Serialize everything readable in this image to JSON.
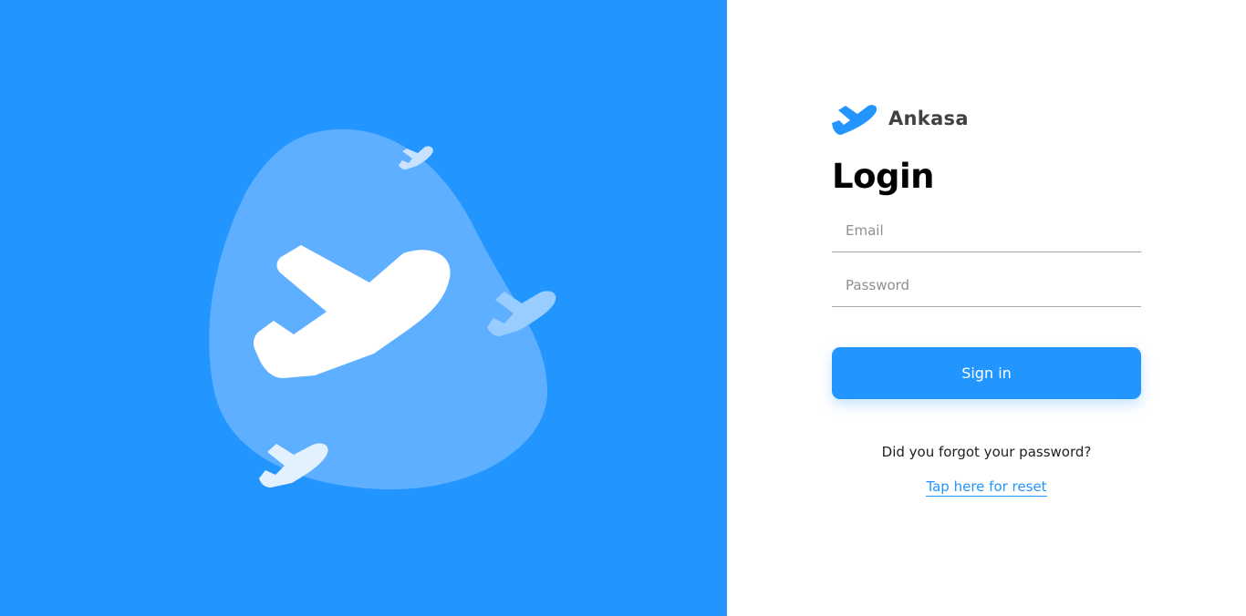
{
  "colors": {
    "primary": "#2395FF",
    "blob": "#5EAFFF",
    "title": "#000000",
    "brand_text": "#414141"
  },
  "hero": {
    "illustration_icon": "airplane-icon"
  },
  "brand": {
    "logo_icon": "airplane-logo-icon",
    "name": "Ankasa"
  },
  "login": {
    "title": "Login",
    "email": {
      "placeholder": "Email",
      "value": ""
    },
    "password": {
      "placeholder": "Password",
      "value": ""
    },
    "signin_label": "Sign in",
    "forgot_text": "Did you forgot your password?",
    "reset_link": "Tap here for reset"
  }
}
